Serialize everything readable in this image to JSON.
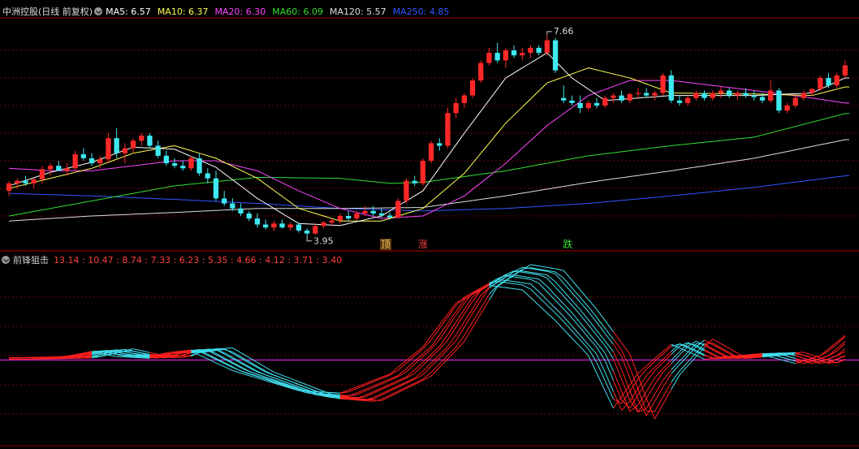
{
  "header": {
    "title": "中洲控股(日线 前复权)",
    "ma": [
      {
        "label": "MA5",
        "value": "6.57",
        "color": "#ffffff"
      },
      {
        "label": "MA10",
        "value": "6.37",
        "color": "#ffff55"
      },
      {
        "label": "MA20",
        "value": "6.30",
        "color": "#ff44ff"
      },
      {
        "label": "MA60",
        "value": "6.09",
        "color": "#33dd33"
      },
      {
        "label": "MA120",
        "value": "5.57",
        "color": "#dddddd"
      },
      {
        "label": "MA250",
        "value": "4.85",
        "color": "#3355ff"
      }
    ]
  },
  "indicator": {
    "name": "前锋狙击",
    "values": "13.14 : 10.47 : 8.74 : 7.33 : 6.23 : 5.35 : 4.66 : 4.12 : 3.71 : 3.40",
    "colors": {
      "up": "#ff2020",
      "down": "#40e0f0",
      "baseline": "#cc22cc"
    }
  },
  "chart_data": [
    {
      "type": "candlestick",
      "title": "中洲控股(日线 前复权)",
      "annotations": [
        {
          "text": "7.66",
          "kind": "high"
        },
        {
          "text": "3.95",
          "kind": "low"
        }
      ],
      "signals": [
        {
          "text": "顶",
          "color": "#ffcc66"
        },
        {
          "text": "涨",
          "color": "#ff4040"
        },
        {
          "text": "跌",
          "color": "#33dd33"
        }
      ],
      "candles": [
        [
          4.55,
          4.75,
          4.45,
          4.7
        ],
        [
          4.7,
          4.8,
          4.6,
          4.75
        ],
        [
          4.75,
          4.85,
          4.65,
          4.7
        ],
        [
          4.7,
          4.8,
          4.6,
          4.78
        ],
        [
          4.78,
          5.05,
          4.7,
          4.98
        ],
        [
          4.98,
          5.1,
          4.85,
          5.05
        ],
        [
          5.05,
          5.15,
          4.95,
          4.95
        ],
        [
          4.95,
          5.1,
          4.85,
          5.0
        ],
        [
          5.0,
          5.35,
          4.95,
          5.28
        ],
        [
          5.28,
          5.4,
          5.15,
          5.2
        ],
        [
          5.2,
          5.3,
          5.05,
          5.1
        ],
        [
          5.1,
          5.25,
          5.0,
          5.18
        ],
        [
          5.18,
          5.7,
          5.1,
          5.6
        ],
        [
          5.6,
          5.8,
          5.2,
          5.3
        ],
        [
          5.3,
          5.5,
          5.1,
          5.4
        ],
        [
          5.4,
          5.6,
          5.3,
          5.55
        ],
        [
          5.55,
          5.7,
          5.45,
          5.65
        ],
        [
          5.65,
          5.7,
          5.4,
          5.45
        ],
        [
          5.45,
          5.55,
          5.2,
          5.25
        ],
        [
          5.25,
          5.35,
          5.05,
          5.1
        ],
        [
          5.1,
          5.2,
          5.0,
          5.05
        ],
        [
          5.05,
          5.15,
          4.95,
          5.0
        ],
        [
          5.0,
          5.25,
          4.95,
          5.2
        ],
        [
          5.2,
          5.3,
          4.85,
          4.9
        ],
        [
          4.9,
          5.0,
          4.7,
          4.8
        ],
        [
          4.8,
          4.95,
          4.35,
          4.4
        ],
        [
          4.4,
          4.55,
          4.25,
          4.3
        ],
        [
          4.3,
          4.4,
          4.15,
          4.2
        ],
        [
          4.2,
          4.3,
          4.05,
          4.1
        ],
        [
          4.1,
          4.15,
          3.95,
          4.0
        ],
        [
          4.0,
          4.1,
          3.82,
          3.88
        ],
        [
          3.88,
          3.98,
          3.78,
          3.82
        ],
        [
          3.82,
          3.95,
          3.75,
          3.9
        ],
        [
          3.9,
          3.98,
          3.8,
          3.82
        ],
        [
          3.82,
          3.92,
          3.76,
          3.88
        ],
        [
          3.88,
          3.92,
          3.72,
          3.76
        ],
        [
          3.76,
          3.8,
          3.65,
          3.7
        ],
        [
          3.7,
          3.9,
          3.68,
          3.85
        ],
        [
          3.85,
          3.95,
          3.8,
          3.92
        ],
        [
          3.92,
          4.0,
          3.85,
          3.96
        ],
        [
          3.96,
          4.1,
          3.9,
          4.05
        ],
        [
          4.05,
          4.15,
          3.95,
          4.0
        ],
        [
          4.0,
          4.15,
          3.95,
          4.1
        ],
        [
          4.1,
          4.25,
          4.05,
          4.15
        ],
        [
          4.15,
          4.25,
          4.05,
          4.1
        ],
        [
          4.1,
          4.2,
          4.02,
          4.06
        ],
        [
          4.06,
          4.12,
          3.98,
          4.02
        ],
        [
          4.02,
          4.4,
          4.0,
          4.35
        ],
        [
          4.35,
          4.8,
          4.3,
          4.75
        ],
        [
          4.75,
          4.85,
          4.65,
          4.7
        ],
        [
          4.7,
          5.2,
          4.65,
          5.15
        ],
        [
          5.15,
          5.55,
          5.1,
          5.5
        ],
        [
          5.5,
          5.6,
          5.35,
          5.45
        ],
        [
          5.45,
          6.2,
          5.4,
          6.1
        ],
        [
          6.1,
          6.4,
          6.0,
          6.3
        ],
        [
          6.3,
          6.5,
          6.2,
          6.45
        ],
        [
          6.45,
          6.8,
          6.4,
          6.75
        ],
        [
          6.75,
          7.15,
          6.7,
          7.1
        ],
        [
          7.1,
          7.4,
          7.05,
          7.3
        ],
        [
          7.3,
          7.5,
          7.1,
          7.15
        ],
        [
          7.15,
          7.4,
          7.0,
          7.35
        ],
        [
          7.35,
          7.45,
          7.2,
          7.25
        ],
        [
          7.25,
          7.4,
          7.15,
          7.3
        ],
        [
          7.3,
          7.45,
          7.2,
          7.4
        ],
        [
          7.4,
          7.45,
          7.25,
          7.3
        ],
        [
          7.3,
          7.66,
          7.25,
          7.55
        ],
        [
          7.55,
          7.6,
          6.9,
          6.95
        ],
        [
          6.4,
          6.65,
          6.3,
          6.35
        ],
        [
          6.35,
          6.45,
          6.25,
          6.3
        ],
        [
          6.3,
          6.45,
          6.1,
          6.2
        ],
        [
          6.2,
          6.35,
          6.15,
          6.3
        ],
        [
          6.3,
          6.4,
          6.2,
          6.25
        ],
        [
          6.25,
          6.45,
          6.2,
          6.4
        ],
        [
          6.4,
          6.5,
          6.3,
          6.45
        ],
        [
          6.45,
          6.55,
          6.3,
          6.35
        ],
        [
          6.35,
          6.5,
          6.3,
          6.48
        ],
        [
          6.48,
          6.6,
          6.4,
          6.5
        ],
        [
          6.5,
          6.6,
          6.4,
          6.45
        ],
        [
          6.45,
          6.55,
          6.35,
          6.5
        ],
        [
          6.5,
          6.9,
          6.45,
          6.85
        ],
        [
          6.85,
          6.95,
          6.3,
          6.35
        ],
        [
          6.35,
          6.45,
          6.25,
          6.3
        ],
        [
          6.3,
          6.45,
          6.25,
          6.4
        ],
        [
          6.4,
          6.55,
          6.35,
          6.5
        ],
        [
          6.5,
          6.55,
          6.35,
          6.4
        ],
        [
          6.4,
          6.55,
          6.35,
          6.5
        ],
        [
          6.5,
          6.62,
          6.4,
          6.55
        ],
        [
          6.55,
          6.6,
          6.4,
          6.45
        ],
        [
          6.45,
          6.55,
          6.35,
          6.5
        ],
        [
          6.5,
          6.6,
          6.4,
          6.45
        ],
        [
          6.45,
          6.55,
          6.35,
          6.42
        ],
        [
          6.42,
          6.5,
          6.3,
          6.35
        ],
        [
          6.35,
          6.75,
          6.3,
          6.55
        ],
        [
          6.55,
          6.6,
          6.1,
          6.15
        ],
        [
          6.15,
          6.3,
          6.1,
          6.25
        ],
        [
          6.25,
          6.45,
          6.2,
          6.4
        ],
        [
          6.4,
          6.55,
          6.35,
          6.5
        ],
        [
          6.5,
          6.6,
          6.45,
          6.58
        ],
        [
          6.58,
          6.85,
          6.55,
          6.8
        ],
        [
          6.8,
          6.9,
          6.6,
          6.65
        ],
        [
          6.65,
          6.9,
          6.6,
          6.85
        ],
        [
          6.85,
          7.15,
          6.8,
          7.05
        ]
      ],
      "ma": {
        "MA5": [
          [
            0,
            4.65
          ],
          [
            5,
            4.92
          ],
          [
            10,
            5.12
          ],
          [
            15,
            5.42
          ],
          [
            20,
            5.38
          ],
          [
            25,
            5.02
          ],
          [
            30,
            4.4
          ],
          [
            35,
            3.9
          ],
          [
            40,
            3.86
          ],
          [
            45,
            4.05
          ],
          [
            50,
            4.55
          ],
          [
            55,
            5.7
          ],
          [
            60,
            6.8
          ],
          [
            65,
            7.3
          ],
          [
            68,
            6.8
          ],
          [
            72,
            6.35
          ],
          [
            80,
            6.45
          ],
          [
            90,
            6.45
          ],
          [
            97,
            6.5
          ],
          [
            101,
            6.8
          ]
        ],
        "MA10": [
          [
            0,
            4.6
          ],
          [
            5,
            4.8
          ],
          [
            10,
            5.0
          ],
          [
            15,
            5.3
          ],
          [
            20,
            5.45
          ],
          [
            25,
            5.2
          ],
          [
            30,
            4.8
          ],
          [
            35,
            4.2
          ],
          [
            40,
            3.95
          ],
          [
            45,
            3.95
          ],
          [
            50,
            4.2
          ],
          [
            55,
            4.9
          ],
          [
            60,
            5.9
          ],
          [
            65,
            6.7
          ],
          [
            70,
            7.0
          ],
          [
            75,
            6.8
          ],
          [
            80,
            6.5
          ],
          [
            90,
            6.48
          ],
          [
            97,
            6.45
          ],
          [
            101,
            6.62
          ]
        ],
        "MA20": [
          [
            0,
            5.0
          ],
          [
            5,
            4.95
          ],
          [
            10,
            4.95
          ],
          [
            15,
            5.05
          ],
          [
            20,
            5.15
          ],
          [
            25,
            5.15
          ],
          [
            30,
            4.95
          ],
          [
            35,
            4.55
          ],
          [
            40,
            4.2
          ],
          [
            45,
            4.0
          ],
          [
            50,
            4.05
          ],
          [
            55,
            4.45
          ],
          [
            60,
            5.1
          ],
          [
            65,
            5.85
          ],
          [
            70,
            6.45
          ],
          [
            75,
            6.75
          ],
          [
            80,
            6.75
          ],
          [
            85,
            6.65
          ],
          [
            90,
            6.55
          ],
          [
            97,
            6.4
          ],
          [
            101,
            6.3
          ]
        ],
        "MA60": [
          [
            0,
            4.05
          ],
          [
            10,
            4.35
          ],
          [
            20,
            4.65
          ],
          [
            30,
            4.82
          ],
          [
            40,
            4.8
          ],
          [
            46,
            4.7
          ],
          [
            50,
            4.72
          ],
          [
            60,
            4.95
          ],
          [
            70,
            5.25
          ],
          [
            80,
            5.45
          ],
          [
            90,
            5.62
          ],
          [
            101,
            6.09
          ]
        ],
        "MA120": [
          [
            0,
            3.95
          ],
          [
            10,
            4.05
          ],
          [
            20,
            4.12
          ],
          [
            30,
            4.2
          ],
          [
            40,
            4.2
          ],
          [
            50,
            4.22
          ],
          [
            60,
            4.45
          ],
          [
            70,
            4.72
          ],
          [
            80,
            4.95
          ],
          [
            90,
            5.2
          ],
          [
            101,
            5.57
          ]
        ],
        "MA250": [
          [
            0,
            4.5
          ],
          [
            10,
            4.45
          ],
          [
            20,
            4.38
          ],
          [
            30,
            4.3
          ],
          [
            40,
            4.2
          ],
          [
            50,
            4.15
          ],
          [
            60,
            4.2
          ],
          [
            70,
            4.3
          ],
          [
            80,
            4.45
          ],
          [
            90,
            4.62
          ],
          [
            101,
            4.85
          ]
        ]
      },
      "ylim": [
        3.5,
        7.9
      ]
    },
    {
      "type": "line",
      "title": "前锋狙击",
      "baseline": 0,
      "lines": 10,
      "base_curve": [
        [
          0,
          0.1
        ],
        [
          6,
          0.2
        ],
        [
          10,
          0.9
        ],
        [
          13,
          0.4
        ],
        [
          17,
          0.2
        ],
        [
          18,
          0.6
        ],
        [
          22,
          1.0
        ],
        [
          27,
          -1.2
        ],
        [
          35,
          -3.5
        ],
        [
          40,
          -3.8
        ],
        [
          46,
          -1.6
        ],
        [
          50,
          1.5
        ],
        [
          54,
          6.5
        ],
        [
          58,
          8.5
        ],
        [
          62,
          8.0
        ],
        [
          66,
          4.5
        ],
        [
          70,
          0.5
        ],
        [
          73,
          -5.5
        ],
        [
          76,
          -1.5
        ],
        [
          80,
          1.8
        ],
        [
          84,
          0.1
        ],
        [
          87,
          0.3
        ],
        [
          91,
          0.6
        ],
        [
          95,
          -0.4
        ],
        [
          98,
          0.5
        ],
        [
          101,
          2.8
        ]
      ],
      "ylim": [
        -9.5,
        10.5
      ]
    }
  ]
}
